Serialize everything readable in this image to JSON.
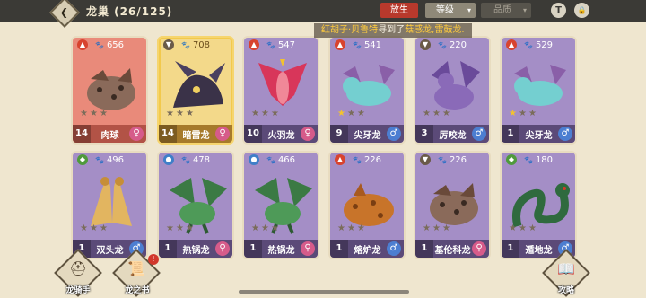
{
  "header": {
    "title": "龙巢 (26/125)",
    "release_label": "放生",
    "sort_label": "等级",
    "quality_label": "品质",
    "chevron": "▾",
    "back_glyph": "❮",
    "filter_glyph": "T",
    "lock_glyph": "🔒"
  },
  "notice": {
    "player": "红胡子·贝鲁特",
    "middle": "寻到了",
    "found": "菇感龙,雷鼓龙."
  },
  "cards": [
    {
      "power": "656",
      "level": "14",
      "name": "肉球",
      "gender": "♀",
      "stars": 0,
      "theme": "c-red",
      "element": "fire",
      "art": "blob"
    },
    {
      "power": "708",
      "level": "14",
      "name": "暗雷龙",
      "gender": "♀",
      "stars": 0,
      "theme": "c-gold",
      "element": "earth",
      "art": "dragon"
    },
    {
      "power": "547",
      "level": "10",
      "name": "火羽龙",
      "gender": "♀",
      "stars": 0,
      "theme": "",
      "element": "fire",
      "art": "bird"
    },
    {
      "power": "541",
      "level": "9",
      "name": "尖牙龙",
      "gender": "♂",
      "stars": 1,
      "theme": "",
      "element": "fire",
      "art": "cyan"
    },
    {
      "power": "220",
      "level": "3",
      "name": "厉咬龙",
      "gender": "♂",
      "stars": 0,
      "theme": "",
      "element": "earth",
      "art": "purple"
    },
    {
      "power": "529",
      "level": "1",
      "name": "尖牙龙",
      "gender": "♂",
      "stars": 1,
      "theme": "",
      "element": "fire",
      "art": "cyan"
    },
    {
      "power": "496",
      "level": "1",
      "name": "双头龙",
      "gender": "♂",
      "stars": 0,
      "theme": "",
      "element": "leaf",
      "art": "twin"
    },
    {
      "power": "478",
      "level": "1",
      "name": "热锅龙",
      "gender": "♀",
      "stars": 0,
      "theme": "",
      "element": "water",
      "art": "green"
    },
    {
      "power": "466",
      "level": "1",
      "name": "热锅龙",
      "gender": "♀",
      "stars": 0,
      "theme": "",
      "element": "water",
      "art": "green"
    },
    {
      "power": "226",
      "level": "1",
      "name": "熔炉龙",
      "gender": "♂",
      "stars": 0,
      "theme": "",
      "element": "fire",
      "art": "orange"
    },
    {
      "power": "226",
      "level": "1",
      "name": "基伦科龙",
      "gender": "♀",
      "stars": 0,
      "theme": "",
      "element": "earth",
      "art": "blob"
    },
    {
      "power": "180",
      "level": "1",
      "name": "遁地龙",
      "gender": "♂",
      "stars": 0,
      "theme": "",
      "element": "leaf",
      "art": "serpent"
    }
  ],
  "bottom_nav": {
    "rider_label": "龙骑手",
    "book_label": "龙之书",
    "book_badge": "!",
    "guide_label": "攻略"
  },
  "colors": {
    "topbar": "#3b3a36",
    "card_purple": "#a48ec6",
    "release_red": "#b8392c",
    "star_gold": "#f2c230"
  }
}
